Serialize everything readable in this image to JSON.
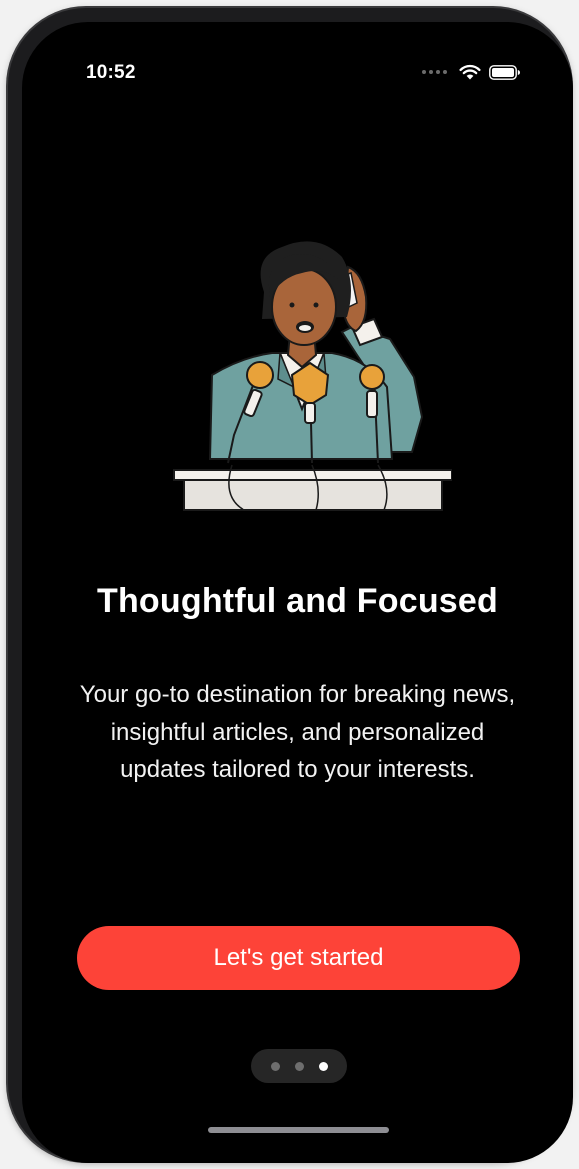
{
  "status_bar": {
    "time": "10:52",
    "icons": [
      "cellular-signal-icon",
      "wifi-icon",
      "battery-icon"
    ]
  },
  "illustration": {
    "name": "speaker-at-podium-illustration"
  },
  "onboarding": {
    "title": "Thoughtful and Focused",
    "description": "Your go-to destination for breaking news, insightful articles, and personalized updates tailored to your interests.",
    "cta_label": "Let's get started"
  },
  "page_indicator": {
    "total_pages": 3,
    "current_page": 3
  },
  "colors": {
    "background": "#000000",
    "accent": "#fd4338",
    "text": "#ffffff",
    "indicator_active": "#ffffff",
    "indicator_inactive": "#6e6e6e"
  }
}
